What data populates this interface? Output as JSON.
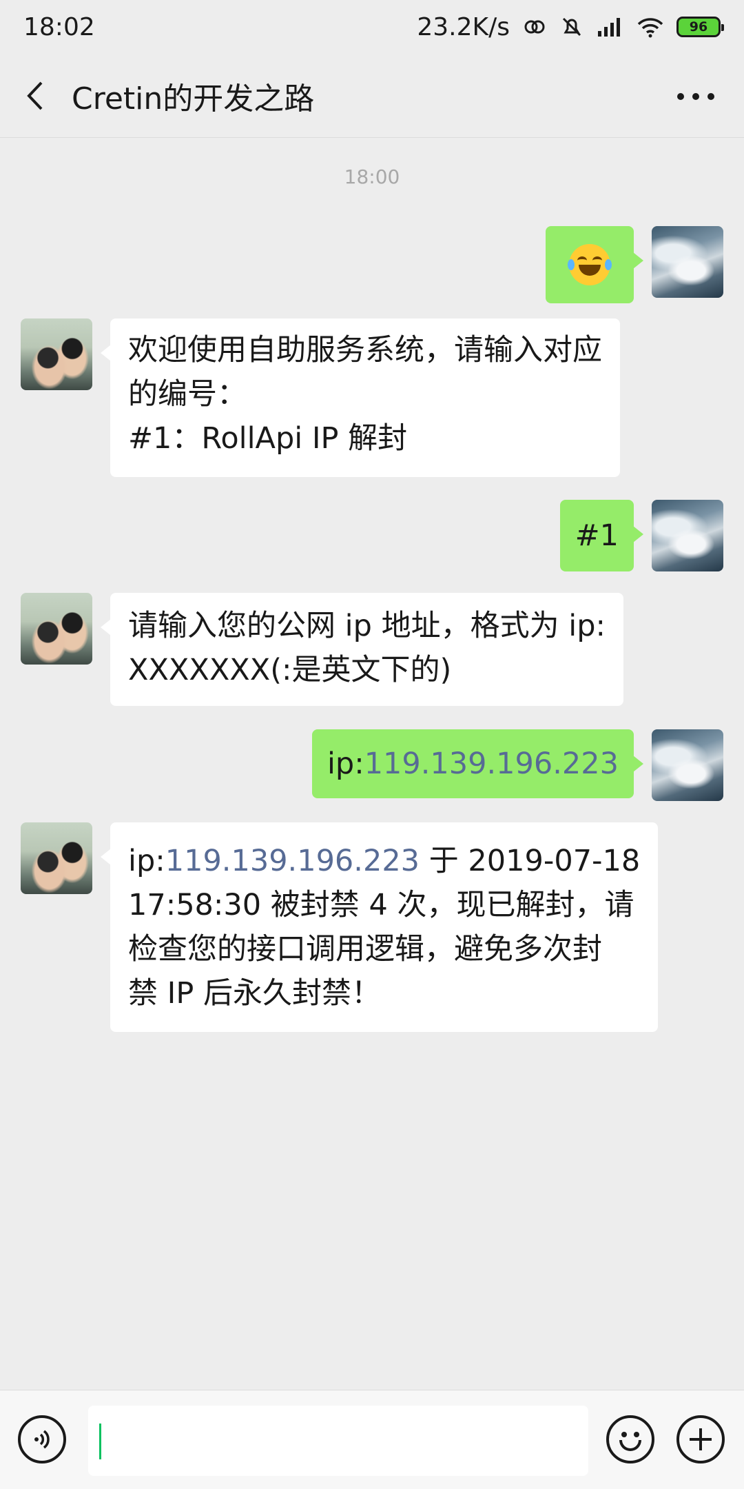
{
  "status_bar": {
    "time": "18:02",
    "network_speed": "23.2K/s",
    "battery": "96",
    "icons": [
      "link-icon",
      "mute-bell-icon",
      "signal-icon",
      "wifi-icon",
      "battery-icon"
    ]
  },
  "header": {
    "title": "Cretin的开发之路",
    "back_icon": "chevron-left-icon",
    "more_icon": "more-dots-icon"
  },
  "time_divider": "18:00",
  "messages": [
    {
      "side": "right",
      "type": "emoji",
      "emoji": "face-with-tears-of-joy"
    },
    {
      "side": "left",
      "lines": [
        "欢迎使用自助服务系统，请输入对应",
        "的编号：",
        "#1：RollApi IP 解封"
      ]
    },
    {
      "side": "right",
      "text": "#1"
    },
    {
      "side": "left",
      "lines": [
        "请输入您的公网 ip 地址，格式为 ip:",
        "XXXXXXX(:是英文下的)"
      ]
    },
    {
      "side": "right",
      "prefix": "ip:",
      "link": "119.139.196.223"
    },
    {
      "side": "left",
      "prefix": "ip:",
      "link": "119.139.196.223",
      "line1_rest": " 于 2019-07-18",
      "lines": [
        "17:58:30 被封禁 4 次，现已解封，请",
        "检查您的接口调用逻辑，避免多次封",
        "禁 IP 后永久封禁！"
      ]
    }
  ],
  "input_bar": {
    "voice_icon": "voice-icon",
    "emoji_icon": "emoji-icon",
    "plus_icon": "plus-icon",
    "value": ""
  },
  "colors": {
    "background": "#ededed",
    "my_bubble": "#95ec69",
    "their_bubble": "#ffffff",
    "link": "#576b95",
    "caret": "#07c160"
  }
}
